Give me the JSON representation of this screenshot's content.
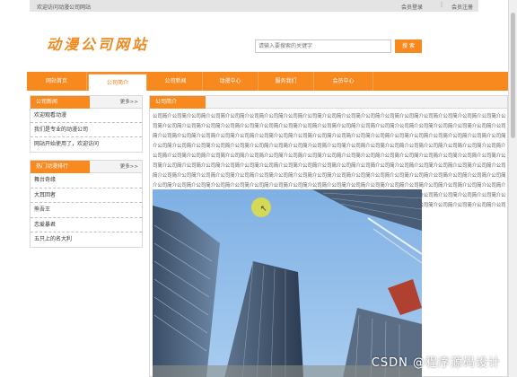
{
  "topbar": {
    "welcome": "欢迎访问动漫公司网站",
    "login": "会员登录",
    "separator": "|",
    "register": "会员注册"
  },
  "header": {
    "logo": "动漫公司网站",
    "search_placeholder": "请输入要搜索的关键字",
    "search_button": "搜 索"
  },
  "nav": {
    "items": [
      {
        "label": "网站首页",
        "active": false
      },
      {
        "label": "公司简介",
        "active": true
      },
      {
        "label": "公司新闻",
        "active": false
      },
      {
        "label": "动漫中心",
        "active": false
      },
      {
        "label": "服务我们",
        "active": false
      },
      {
        "label": "会员中心",
        "active": false
      }
    ]
  },
  "news_panel": {
    "title": "公司新闻",
    "more": "更多>>",
    "items": [
      "欢迎观看动漫",
      "我们是专业的动漫公司",
      "网站开始使用了，欢迎访问"
    ]
  },
  "ranking_panel": {
    "title": "热门动漫排行",
    "more": "更多>>",
    "items": [
      "舞台奇缘",
      "大耳回者",
      "熊吾王",
      "恋爱暴君",
      "五只上的名大利"
    ]
  },
  "content": {
    "title": "公司简介",
    "body": "公司简介公司简介公司简介公司简介公司简介公司简介公司简介公司简介公司简介公司简介公司简介公司简介公司简介公司简介公司简介公司简介公司简介公司简介公司简介公司简介公司简介公司简介公司简介公司简介公司简介公司简介公司简介公司简介公司简介公司简介公司简介公司简介公司简介公司简介公司简介公司简介公司简介公司简介公司简介公司简介公司简介公司简介公司简介公司简介公司简介公司简介公司简介公司简介公司简介公司简介公司简介公司简介公司简介公司简介公司简介公司简介公司简介公司简介公司简介公司简介公司简介公司简介公司简介公司简介公司简介公司简介公司简介公司简介公司简介公司简介公司简介公司简介公司简介公司简介公司简介公司简介公司简介公司简介公司简介公司简介公司简介公司简介公司简介公司简介公司简介公司简介公司简介公司简介公司简介公司简介公司简介公司简介公司简介公司简介公司简介公司简介公司简介公司简介公司简介公司简介公司简介公司简介公司简介公司简介公司简介公司简介公司简介公司简介公司简介公司简介公司简介公司简介公司简介公司简介公司简介公司简介公司简介公司简介公司简介公司简介公司简介公司简介公司简介公司简介公司简介公司简介公司简介公司简介公司简介公司简介公司简介公司简介公司简介公司简介公司简介公司简介公司简介公司简介公司简介公司简介公司简介公司简介公司简介公司简介公司简介公司简介公司简介公司简介公司简介公司简介公司简介公司简介公司简介公司简介公司简介公司简介公司简介公司简介公司简介公司简介公司简介公司简介公司简介公司简介公司简介公司简介公司简介公司简介公司简介公司简介公司简介公司简介公司简介公司简介公司简介公司简介公司简介公司简介公司简介公司简介公司简介公司简介公司简介公司简介公司简介公司简介公司简介公司简介公司简介公司简介公司简介公司简介公司简介公司简介公司简介公司简介"
  },
  "watermark": "CSDN @程序源码设计",
  "colors": {
    "accent": "#f7891e",
    "topbar": "#e4e4e4",
    "panel_border": "#d9d9d9"
  }
}
